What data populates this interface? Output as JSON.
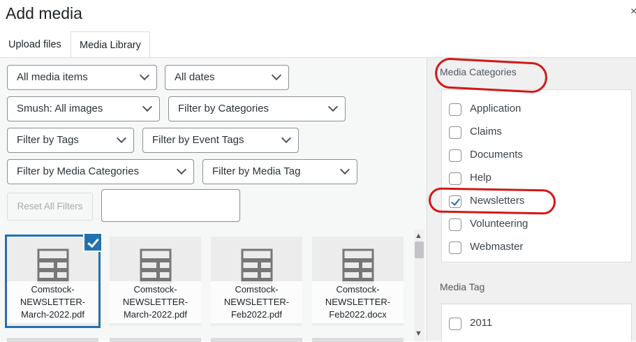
{
  "header": {
    "title": "Add media",
    "close_glyph": "×"
  },
  "tabs": [
    {
      "label": "Upload files",
      "active": false
    },
    {
      "label": "Media Library",
      "active": true
    }
  ],
  "filters": {
    "media_items": "All media items",
    "dates": "All dates",
    "smush": "Smush: All images",
    "categories": "Filter by Categories",
    "tags": "Filter by Tags",
    "event_tags": "Filter by Event Tags",
    "media_categories": "Filter by Media Categories",
    "media_tag": "Filter by Media Tag",
    "reset_label": "Reset All Filters",
    "search_value": ""
  },
  "media": [
    {
      "line1": "Comstock-",
      "line2": "NEWSLETTER-",
      "line3": "March-2022.pdf",
      "selected": true
    },
    {
      "line1": "Comstock-",
      "line2": "NEWSLETTER-",
      "line3": "March-2022.pdf",
      "selected": false
    },
    {
      "line1": "Comstock-",
      "line2": "NEWSLETTER-",
      "line3": "Feb2022.pdf",
      "selected": false
    },
    {
      "line1": "Comstock-",
      "line2": "NEWSLETTER-",
      "line3": "Feb2022.docx",
      "selected": false
    }
  ],
  "sidebar": {
    "media_categories_title": "Media Categories",
    "categories": [
      {
        "label": "Application",
        "checked": false
      },
      {
        "label": "Claims",
        "checked": false
      },
      {
        "label": "Documents",
        "checked": false
      },
      {
        "label": "Help",
        "checked": false
      },
      {
        "label": "Newsletters",
        "checked": true
      },
      {
        "label": "Volunteering",
        "checked": false
      },
      {
        "label": "Webmaster",
        "checked": false
      }
    ],
    "media_tag_title": "Media Tag",
    "tags": [
      {
        "label": "2011",
        "checked": false
      }
    ]
  },
  "colors": {
    "accent": "#2271b1",
    "annotation": "#d11818"
  },
  "icons": [
    "close-icon",
    "chevron-down-icon",
    "document-icon",
    "checkmark-icon"
  ]
}
